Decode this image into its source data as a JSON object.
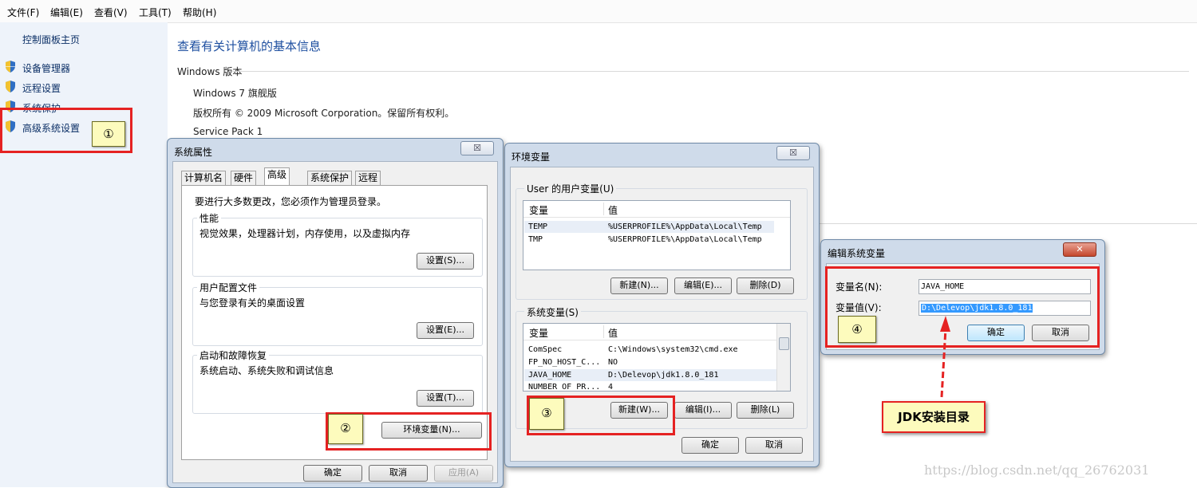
{
  "menu": [
    "文件(F)",
    "编辑(E)",
    "查看(V)",
    "工具(T)",
    "帮助(H)"
  ],
  "sidebar": {
    "home": "控制面板主页",
    "items": [
      "设备管理器",
      "远程设置",
      "系统保护",
      "高级系统设置"
    ]
  },
  "main": {
    "title": "查看有关计算机的基本信息",
    "section": "Windows 版本",
    "edition": "Windows 7 旗舰版",
    "copyright": "版权所有 © 2009 Microsoft Corporation。保留所有权利。",
    "service_pack": "Service Pack 1"
  },
  "sysprops": {
    "title": "系统属性",
    "close": "☒",
    "tabs": [
      "计算机名",
      "硬件",
      "高级",
      "系统保护",
      "远程"
    ],
    "note": "要进行大多数更改，您必须作为管理员登录。",
    "perf_label": "性能",
    "perf_desc": "视觉效果，处理器计划，内存使用，以及虚拟内存",
    "perf_btn": "设置(S)...",
    "profile_label": "用户配置文件",
    "profile_desc": "与您登录有关的桌面设置",
    "profile_btn": "设置(E)...",
    "startup_label": "启动和故障恢复",
    "startup_desc": "系统启动、系统失败和调试信息",
    "startup_btn": "设置(T)...",
    "env_btn": "环境变量(N)...",
    "ok": "确定",
    "cancel": "取消",
    "apply": "应用(A)"
  },
  "envvars": {
    "title": "环境变量",
    "close": "☒",
    "user_label": "User 的用户变量(U)",
    "col_var": "变量",
    "col_val": "值",
    "user_rows": [
      {
        "name": "TEMP",
        "value": "%USERPROFILE%\\AppData\\Local\\Temp"
      },
      {
        "name": "TMP",
        "value": "%USERPROFILE%\\AppData\\Local\\Temp"
      }
    ],
    "user_new": "新建(N)...",
    "user_edit": "编辑(E)...",
    "user_delete": "删除(D)",
    "sys_label": "系统变量(S)",
    "sys_rows": [
      {
        "name": "ComSpec",
        "value": "C:\\Windows\\system32\\cmd.exe"
      },
      {
        "name": "FP_NO_HOST_C...",
        "value": "NO"
      },
      {
        "name": "JAVA_HOME",
        "value": "D:\\Delevop\\jdk1.8.0_181"
      },
      {
        "name": "NUMBER_OF_PR...",
        "value": "4"
      }
    ],
    "sys_new": "新建(W)...",
    "sys_edit": "编辑(I)...",
    "sys_delete": "删除(L)",
    "ok": "确定",
    "cancel": "取消"
  },
  "editvar": {
    "title": "编辑系统变量",
    "close": "✕",
    "name_label": "变量名(N):",
    "name_value": "JAVA_HOME",
    "value_label": "变量值(V):",
    "value_value": "D:\\Delevop\\jdk1.8.0_181",
    "ok": "确定",
    "cancel": "取消"
  },
  "annotations": {
    "step1": "①",
    "step2": "②",
    "step3": "③",
    "step4": "④",
    "callout": "JDK安装目录"
  },
  "watermark": "https://blog.csdn.net/qq_26762031",
  "colors": {
    "annotation_red": "#e52222",
    "badge_yellow": "#fdfbbd",
    "link_blue": "#1e4fa0"
  }
}
